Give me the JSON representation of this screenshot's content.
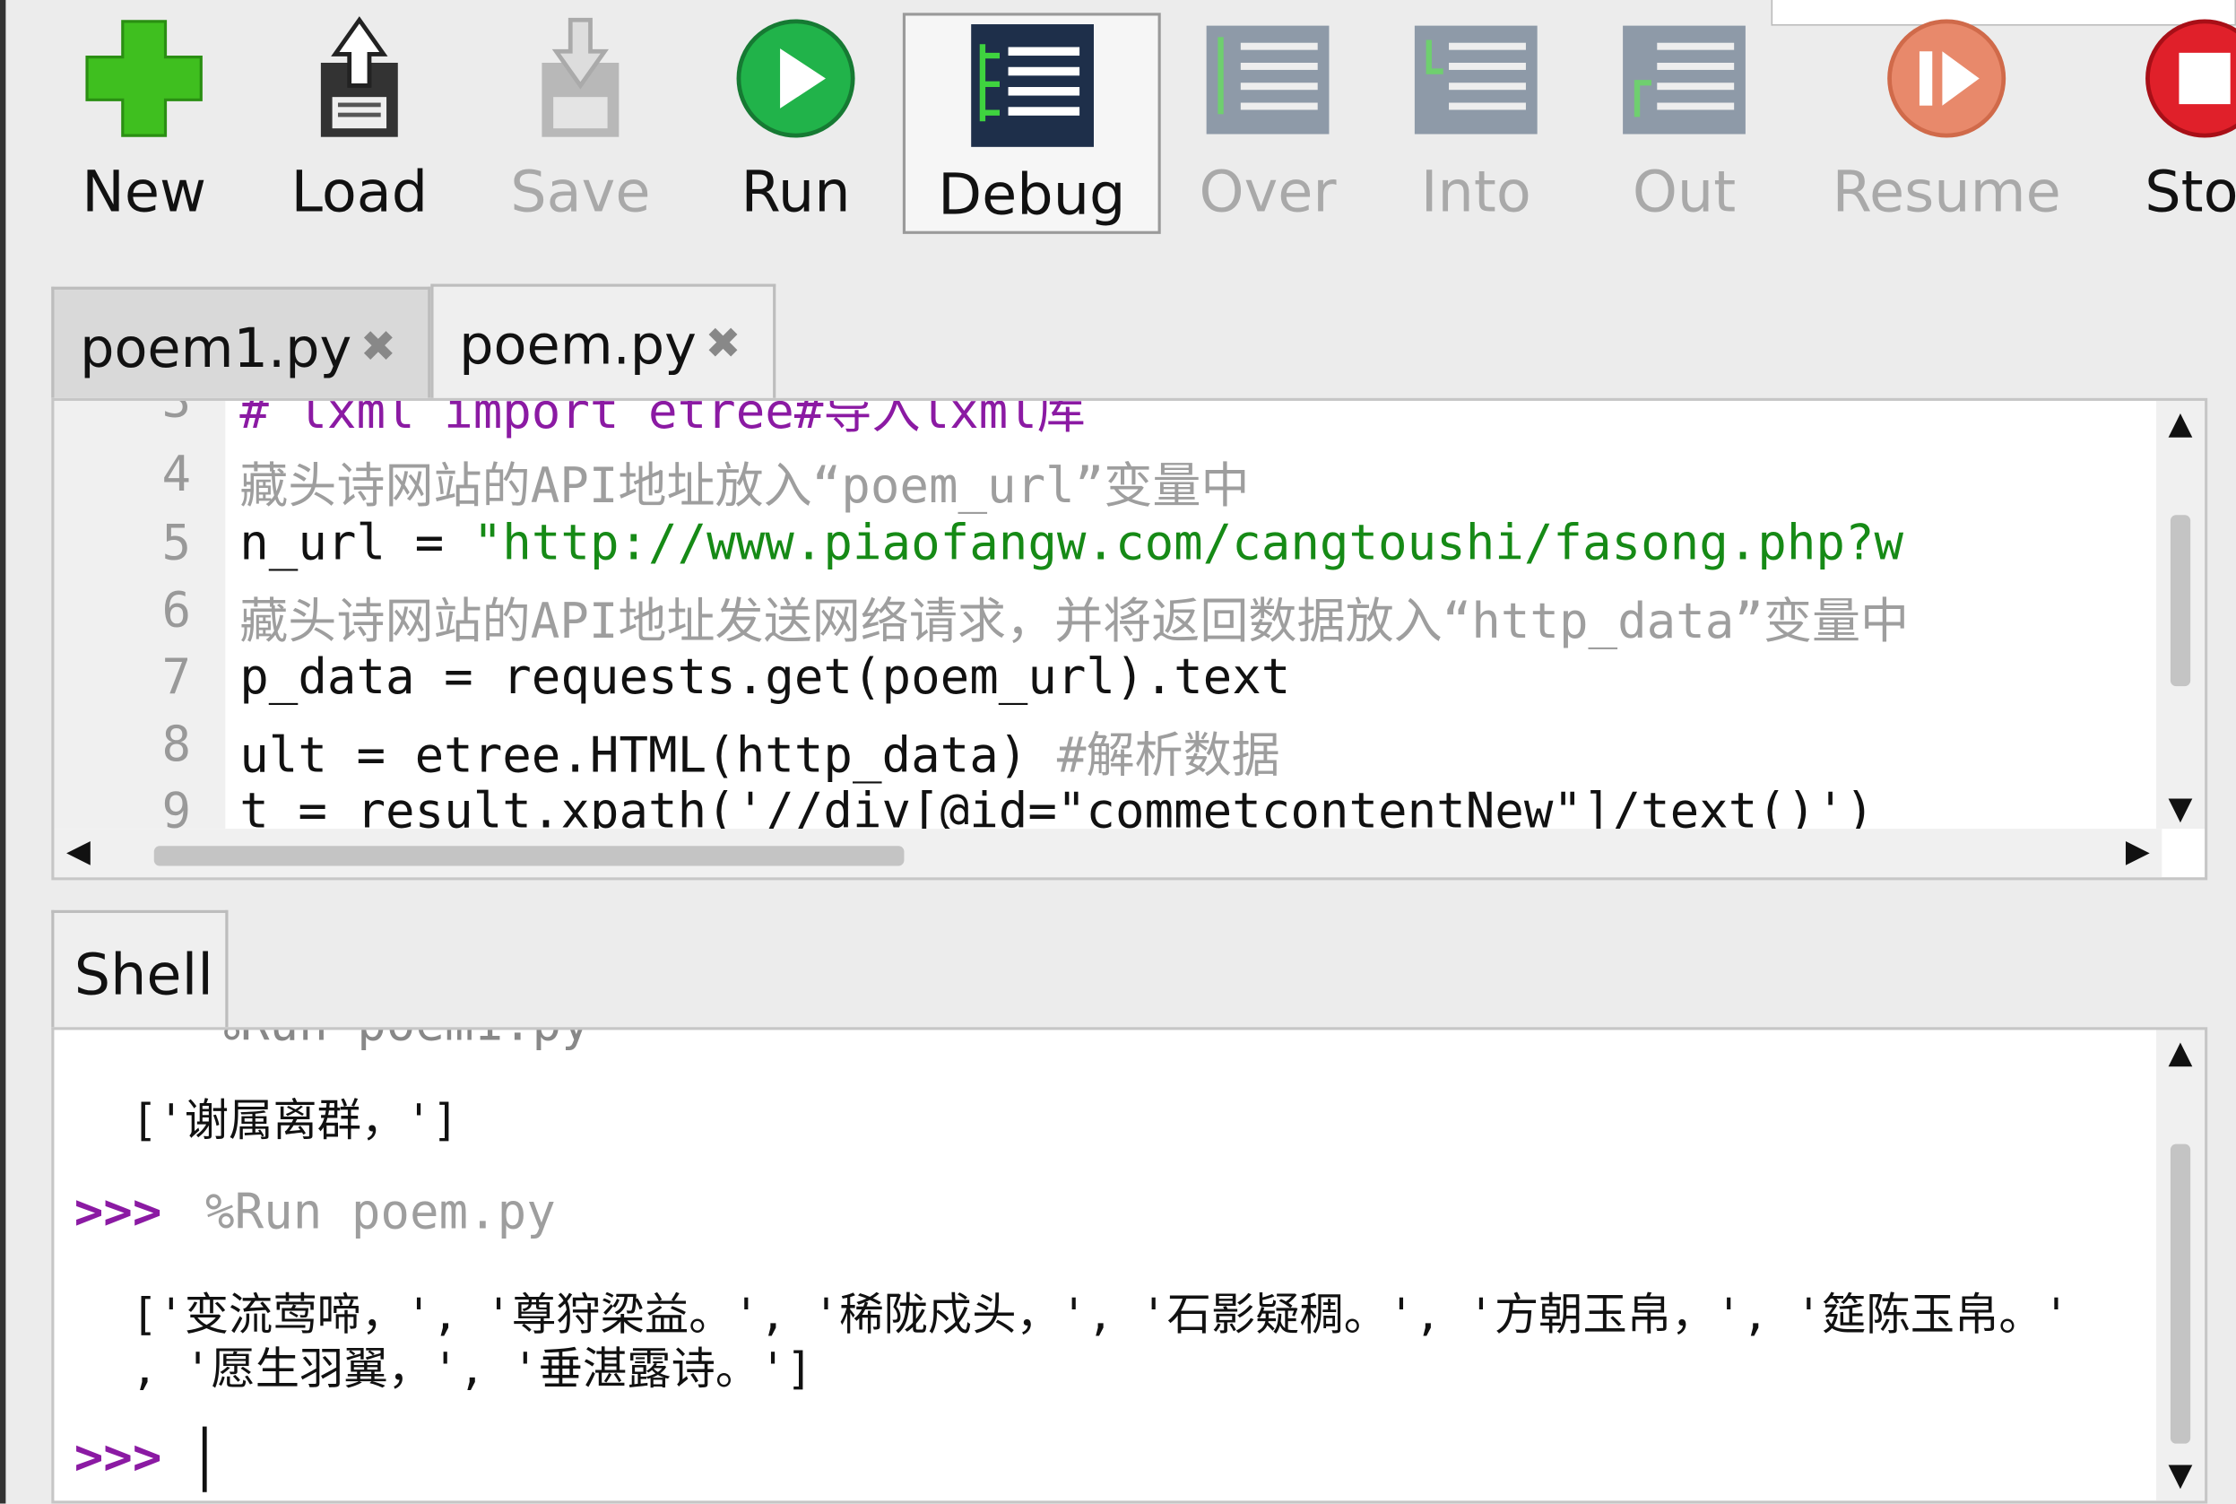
{
  "toolbar": {
    "new": "New",
    "load": "Load",
    "save": "Save",
    "run": "Run",
    "debug": "Debug",
    "over": "Over",
    "into": "Into",
    "out": "Out",
    "resume": "Resume",
    "stop": "Sto"
  },
  "tabs": [
    {
      "label": "poem1.py",
      "close": "✖"
    },
    {
      "label": "poem.py",
      "close": "✖"
    }
  ],
  "editor": {
    "lines": [
      {
        "num": "3",
        "text": "# lxml import etree#导入lxml库"
      },
      {
        "num": "4",
        "text": "藏头诗网站的API地址放入“poem_url”变量中"
      },
      {
        "num": "5",
        "pre": "n_url = ",
        "str": "\"http://www.piaofangw.com/cangtoushi/fasong.php?w"
      },
      {
        "num": "6",
        "text": "藏头诗网站的API地址发送网络请求，并将返回数据放入“http_data”变量中"
      },
      {
        "num": "7",
        "text": "p_data = requests.get(poem_url).text"
      },
      {
        "num": "8",
        "pre": "ult = etree.HTML(http_data) ",
        "cmt": "#解析数据"
      },
      {
        "num": "9",
        "text": "t = result.xpath('//div[@id=\"commetcontentNew\"]/text()')"
      }
    ]
  },
  "shell": {
    "tab_label": "Shell",
    "partial_top": "%Run poem1.py",
    "output1": "['谢属离群，']",
    "prompt": ">>>",
    "command": "%Run poem.py",
    "output2a": "['变流莺啼，', '尊狩梁益。', '稀陇戍头，', '石影疑稠。', '方朝玉帛，', '筵陈玉帛。'",
    "output2b": ", '愿生羽翼，', '垂湛露诗。']"
  },
  "colors": {
    "keyword": "#8b1aa3",
    "string": "#168a16",
    "comment": "#9e9e9e",
    "prompt": "#8b1aa3"
  }
}
